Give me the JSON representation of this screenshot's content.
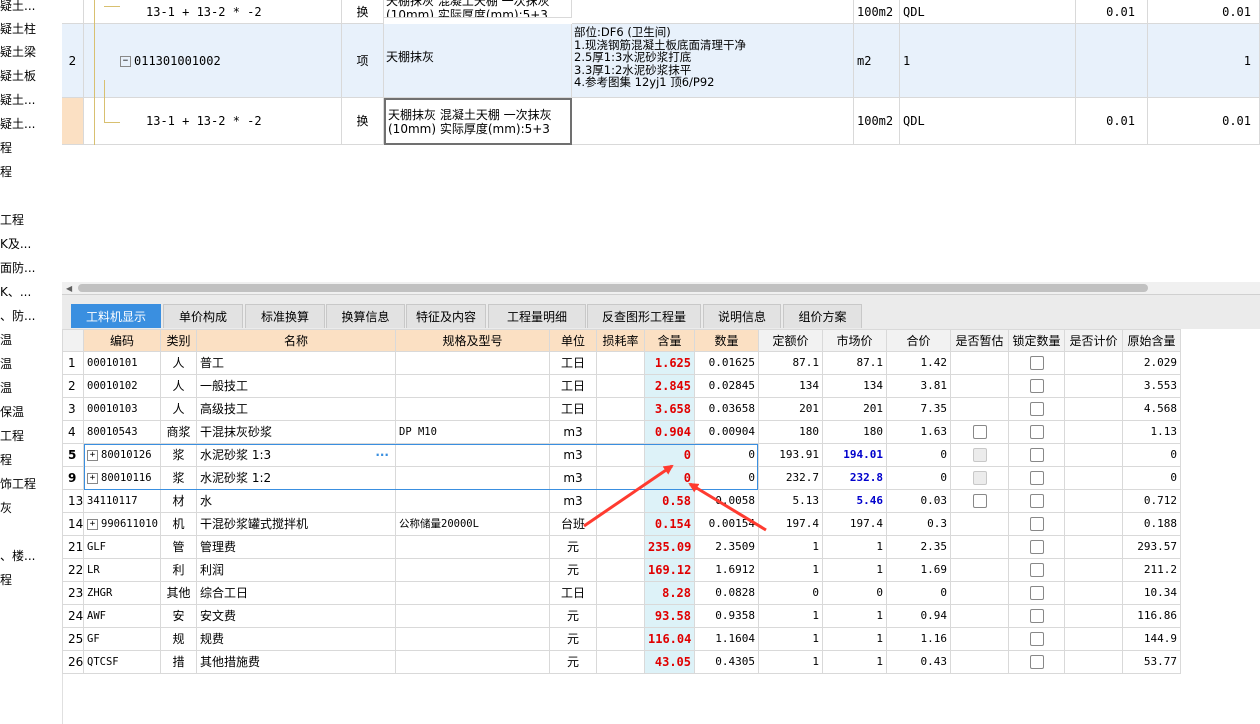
{
  "left_tree": [
    "疑土...",
    "疑土柱",
    "疑土梁",
    "疑土板",
    "疑土...",
    "疑土...",
    "程",
    "程",
    "",
    "工程",
    "K及...",
    "面防...",
    "K、...",
    "、防...",
    "温",
    "温",
    "温",
    "保温",
    "工程",
    "程",
    "饰工程",
    "灰",
    "",
    "、楼...",
    "程"
  ],
  "upper_rows": [
    {
      "num": "",
      "code": "13-1 + 13-2 * -2",
      "type": "换",
      "name": "天棚抹灰 混凝土天棚 一次抹灰\n(10mm) 实际厚度(mm):5+3",
      "feature": "",
      "unit": "100m2",
      "expr": "QDL",
      "qty": "0.01",
      "total": "0.01"
    },
    {
      "num": "2",
      "code": "011301001002",
      "type": "项",
      "name": "天棚抹灰",
      "feature": "部位:DF6 (卫生间)\n1.现浇钢筋混凝土板底面清理干净\n2.5厚1:3水泥砂浆打底\n3.3厚1:2水泥砂浆抹平\n4.参考图集 12yj1 顶6/P92",
      "unit": "m2",
      "expr": "1",
      "qty": "",
      "total": "1"
    },
    {
      "num": "",
      "code": "13-1 + 13-2 * -2",
      "type": "换",
      "name": "天棚抹灰 混凝土天棚 一次抹灰\n(10mm) 实际厚度(mm):5+3",
      "feature": "",
      "unit": "100m2",
      "expr": "QDL",
      "qty": "0.01",
      "total": "0.01"
    }
  ],
  "tabs": [
    "工料机显示",
    "单价构成",
    "标准换算",
    "换算信息",
    "特征及内容",
    "工程量明细",
    "反查图形工程量",
    "说明信息",
    "组价方案"
  ],
  "columns": [
    "编码",
    "类别",
    "名称",
    "规格及型号",
    "单位",
    "损耗率",
    "含量",
    "数量",
    "定额价",
    "市场价",
    "合价",
    "是否暂估",
    "锁定数量",
    "是否计价",
    "原始含量"
  ],
  "rows": [
    {
      "n": "1",
      "code": "00010101",
      "cat": "人",
      "name": "普工",
      "spec": "",
      "unit": "工日",
      "loss": "",
      "content": "1.625",
      "qty": "0.01625",
      "dprice": "87.1",
      "mprice": "87.1",
      "mblue": false,
      "total": "1.42",
      "est": false,
      "lock": true,
      "priced": "",
      "orig": "2.029",
      "expand": false,
      "bold": false
    },
    {
      "n": "2",
      "code": "00010102",
      "cat": "人",
      "name": "一般技工",
      "spec": "",
      "unit": "工日",
      "loss": "",
      "content": "2.845",
      "qty": "0.02845",
      "dprice": "134",
      "mprice": "134",
      "mblue": false,
      "total": "3.81",
      "est": false,
      "lock": true,
      "priced": "",
      "orig": "3.553",
      "expand": false,
      "bold": false
    },
    {
      "n": "3",
      "code": "00010103",
      "cat": "人",
      "name": "高级技工",
      "spec": "",
      "unit": "工日",
      "loss": "",
      "content": "3.658",
      "qty": "0.03658",
      "dprice": "201",
      "mprice": "201",
      "mblue": false,
      "total": "7.35",
      "est": false,
      "lock": true,
      "priced": "",
      "orig": "4.568",
      "expand": false,
      "bold": false
    },
    {
      "n": "4",
      "code": "80010543",
      "cat": "商浆",
      "name": "干混抹灰砂浆",
      "spec": "DP M10",
      "unit": "m3",
      "loss": "",
      "content": "0.904",
      "qty": "0.00904",
      "dprice": "180",
      "mprice": "180",
      "mblue": false,
      "total": "1.63",
      "est": true,
      "lock": true,
      "priced": "",
      "orig": "1.13",
      "expand": false,
      "bold": false
    },
    {
      "n": "5",
      "code": "80010126",
      "cat": "浆",
      "name": "水泥砂浆 1:3",
      "spec": "",
      "unit": "m3",
      "loss": "",
      "content": "0",
      "qty": "0",
      "dprice": "193.91",
      "mprice": "194.01",
      "mblue": true,
      "total": "0",
      "est": "dis",
      "lock": true,
      "priced": "",
      "orig": "0",
      "expand": true,
      "bold": true,
      "ellipsis": "···"
    },
    {
      "n": "9",
      "code": "80010116",
      "cat": "浆",
      "name": "水泥砂浆 1:2",
      "spec": "",
      "unit": "m3",
      "loss": "",
      "content": "0",
      "qty": "0",
      "dprice": "232.7",
      "mprice": "232.8",
      "mblue": true,
      "total": "0",
      "est": "dis",
      "lock": true,
      "priced": "",
      "orig": "0",
      "expand": true,
      "bold": true
    },
    {
      "n": "13",
      "code": "34110117",
      "cat": "材",
      "name": "水",
      "spec": "",
      "unit": "m3",
      "loss": "",
      "content": "0.58",
      "qty": "0.0058",
      "dprice": "5.13",
      "mprice": "5.46",
      "mblue": true,
      "total": "0.03",
      "est": true,
      "lock": true,
      "priced": "",
      "orig": "0.712",
      "expand": false,
      "bold": false
    },
    {
      "n": "14",
      "code": "990611010",
      "cat": "机",
      "name": "干混砂浆罐式搅拌机",
      "spec": "公称储量20000L",
      "unit": "台班",
      "loss": "",
      "content": "0.154",
      "qty": "0.00154",
      "dprice": "197.4",
      "mprice": "197.4",
      "mblue": false,
      "total": "0.3",
      "est": false,
      "lock": true,
      "priced": "",
      "orig": "0.188",
      "expand": true,
      "bold": false
    },
    {
      "n": "21",
      "code": "GLF",
      "cat": "管",
      "name": "管理费",
      "spec": "",
      "unit": "元",
      "loss": "",
      "content": "235.09",
      "qty": "2.3509",
      "dprice": "1",
      "mprice": "1",
      "mblue": false,
      "total": "2.35",
      "est": false,
      "lock": true,
      "priced": "",
      "orig": "293.57",
      "expand": false,
      "bold": false
    },
    {
      "n": "22",
      "code": "LR",
      "cat": "利",
      "name": "利润",
      "spec": "",
      "unit": "元",
      "loss": "",
      "content": "169.12",
      "qty": "1.6912",
      "dprice": "1",
      "mprice": "1",
      "mblue": false,
      "total": "1.69",
      "est": false,
      "lock": true,
      "priced": "",
      "orig": "211.2",
      "expand": false,
      "bold": false
    },
    {
      "n": "23",
      "code": "ZHGR",
      "cat": "其他",
      "name": "综合工日",
      "spec": "",
      "unit": "工日",
      "loss": "",
      "content": "8.28",
      "qty": "0.0828",
      "dprice": "0",
      "mprice": "0",
      "mblue": false,
      "total": "0",
      "est": false,
      "lock": true,
      "priced": "",
      "orig": "10.34",
      "expand": false,
      "bold": false
    },
    {
      "n": "24",
      "code": "AWF",
      "cat": "安",
      "name": "安文费",
      "spec": "",
      "unit": "元",
      "loss": "",
      "content": "93.58",
      "qty": "0.9358",
      "dprice": "1",
      "mprice": "1",
      "mblue": false,
      "total": "0.94",
      "est": false,
      "lock": true,
      "priced": "",
      "orig": "116.86",
      "expand": false,
      "bold": false
    },
    {
      "n": "25",
      "code": "GF",
      "cat": "规",
      "name": "规费",
      "spec": "",
      "unit": "元",
      "loss": "",
      "content": "116.04",
      "qty": "1.1604",
      "dprice": "1",
      "mprice": "1",
      "mblue": false,
      "total": "1.16",
      "est": false,
      "lock": true,
      "priced": "",
      "orig": "144.9",
      "expand": false,
      "bold": false
    },
    {
      "n": "26",
      "code": "QTCSF",
      "cat": "措",
      "name": "其他措施费",
      "spec": "",
      "unit": "元",
      "loss": "",
      "content": "43.05",
      "qty": "0.4305",
      "dprice": "1",
      "mprice": "1",
      "mblue": false,
      "total": "0.43",
      "est": false,
      "lock": true,
      "priced": "",
      "orig": "53.77",
      "expand": false,
      "bold": false
    }
  ],
  "colors": {
    "accent": "#3a8fe0",
    "arrow": "#ff3b30",
    "content_bg": "#ddf2f8",
    "content_text": "#e00000",
    "header_orange": "#fbe0c3"
  },
  "icons": {
    "expand": "plus-box-icon",
    "arrow": "red-arrow-icon"
  }
}
